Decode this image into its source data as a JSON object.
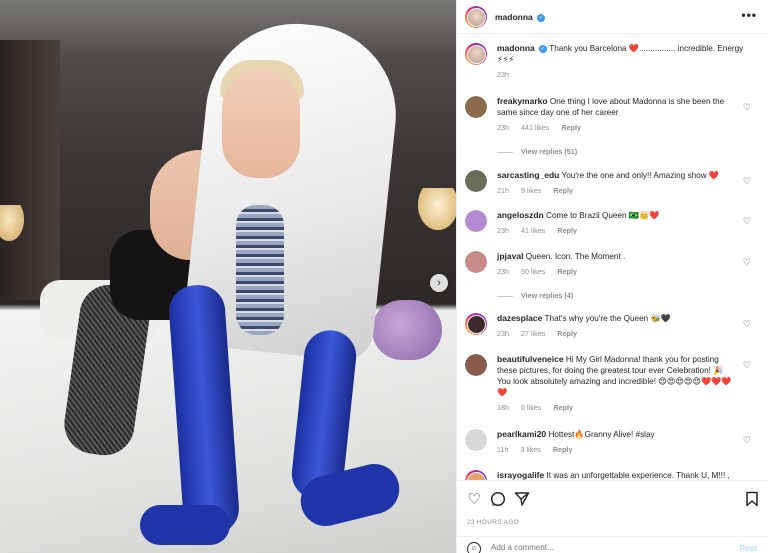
{
  "photo": {
    "next_icon": "chevron-right-icon",
    "next_glyph": "›"
  },
  "header": {
    "username": "madonna",
    "more_glyph": "•••"
  },
  "caption": {
    "username": "madonna",
    "text": "Thank you Barcelona ❤️................ incredible. Energy ⚡⚡⚡",
    "time": "23h"
  },
  "comments": [
    {
      "username": "freakymarko",
      "text": "One thing I love about Madonna is she been the same since day one of her career",
      "time": "23h",
      "likes": "441 likes",
      "reply": "Reply",
      "view_replies": "View replies (51)",
      "avatar_color": "#8a6a4a"
    },
    {
      "username": "sarcasting_edu",
      "text": "You're the one and only!! Amazing show ❤️",
      "time": "21h",
      "likes": "9 likes",
      "reply": "Reply",
      "avatar_color": "#6c6c5a"
    },
    {
      "username": "angeloszdn",
      "text": "Come to Brazil Queen 🇧🇷👑❤️",
      "time": "23h",
      "likes": "41 likes",
      "reply": "Reply",
      "avatar_color": "#b48ad0"
    },
    {
      "username": "jpjaval",
      "text": "Queen. Icon. The Moment .",
      "time": "23h",
      "likes": "60 likes",
      "reply": "Reply",
      "view_replies": "View replies (4)",
      "avatar_color": "#c98a8a"
    },
    {
      "username": "dazesplace",
      "text": "That's why you're the Queen 🐝🖤",
      "time": "23h",
      "likes": "27 likes",
      "reply": "Reply",
      "avatar_color": "#3a2a2a"
    },
    {
      "username": "beautifulveneice",
      "text": "Hi My Girl Madonna! thank you for posting these pictures, for doing the greatest tour ever Celebration! 🎉 You look absolutely amazing and incredible! 😍😍😍😍😍❤️❤️❤️❤️",
      "time": "18h",
      "likes": "6 likes",
      "reply": "Reply",
      "avatar_color": "#8a5a4a"
    },
    {
      "username": "pearlkami20",
      "text": "Hottest🔥Granny Alive! #slay",
      "time": "11h",
      "likes": "3 likes",
      "reply": "Reply",
      "avatar_color": "#d8d8d8"
    },
    {
      "username": "israyogalife",
      "text": "It was an unforgettable experience. Thank U, M!!! ,",
      "time": "",
      "likes": "",
      "reply": "",
      "avatar_color": "#e9a36a"
    }
  ],
  "actions": {
    "like_icon": "heart-icon",
    "comment_icon": "comment-icon",
    "share_icon": "share-icon",
    "save_icon": "bookmark-icon",
    "time_ago": "23 HOURS AGO"
  },
  "add_comment": {
    "placeholder": "Add a comment...",
    "post_label": "Post",
    "emoji_icon": "emoji-icon"
  },
  "colors": {
    "link": "#3897f0",
    "heart_red": "#ed4956",
    "muted": "#8e8e8e",
    "post_disabled": "#b2dffc"
  }
}
